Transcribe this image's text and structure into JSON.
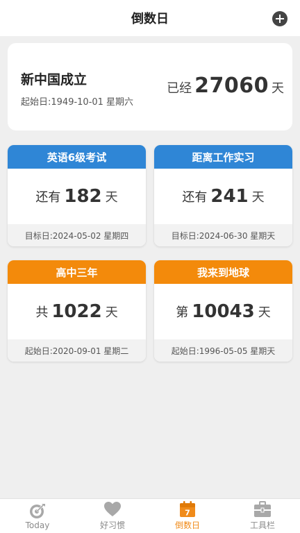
{
  "header": {
    "title": "倒数日"
  },
  "hero": {
    "title": "新中国成立",
    "subtitle": "起始日:1949-10-01 星期六",
    "prefix": "已经",
    "number": "27060",
    "unit": "天"
  },
  "cards": [
    {
      "title": "英语6级考试",
      "prefix": "还有",
      "number": "182",
      "unit": "天",
      "footer": "目标日:2024-05-02 星期四",
      "color": "#2f86d6"
    },
    {
      "title": "距离工作实习",
      "prefix": "还有",
      "number": "241",
      "unit": "天",
      "footer": "目标日:2024-06-30 星期天",
      "color": "#2f86d6"
    },
    {
      "title": "高中三年",
      "prefix": "共",
      "number": "1022",
      "unit": "天",
      "footer": "起始日:2020-09-01 星期二",
      "color": "#f38a0b"
    },
    {
      "title": "我来到地球",
      "prefix": "第",
      "number": "10043",
      "unit": "天",
      "footer": "起始日:1996-05-05 星期天",
      "color": "#f38a0b"
    }
  ],
  "tabbar": {
    "items": [
      {
        "label": "Today",
        "icon": "target-icon"
      },
      {
        "label": "好习惯",
        "icon": "heart-icon"
      },
      {
        "label": "倒数日",
        "icon": "calendar-icon",
        "badge": "7"
      },
      {
        "label": "工具栏",
        "icon": "toolbox-icon"
      }
    ],
    "active_color": "#f08b1a",
    "inactive_color": "#8a8a8a"
  }
}
